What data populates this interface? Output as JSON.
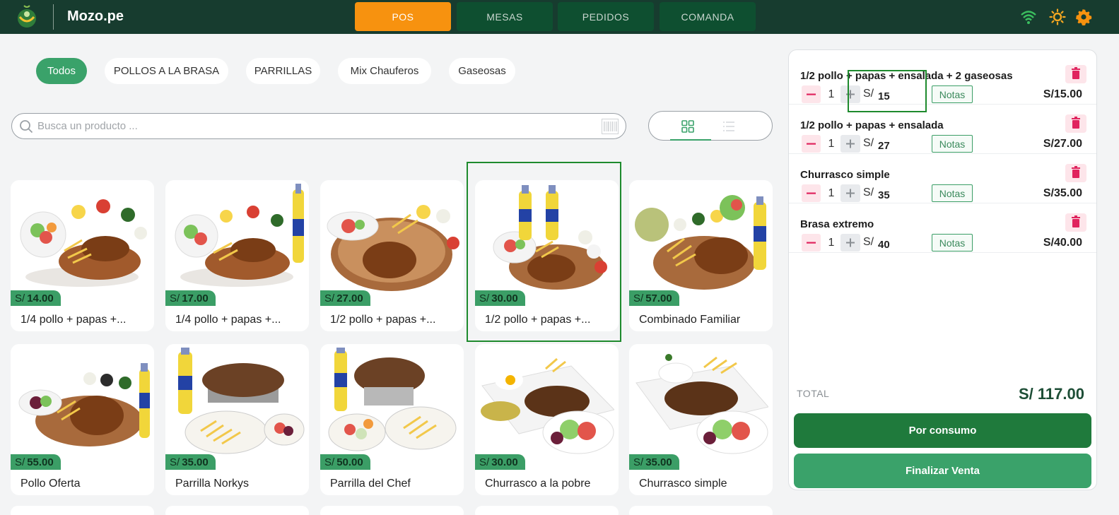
{
  "app": {
    "brand": "Mozo.pe"
  },
  "nav": [
    {
      "label": "POS",
      "active": true
    },
    {
      "label": "MESAS",
      "active": false
    },
    {
      "label": "PEDIDOS",
      "active": false
    },
    {
      "label": "COMANDA",
      "active": false
    }
  ],
  "topicons": [
    "wifi-icon",
    "sun-icon",
    "settings-icon"
  ],
  "categories": [
    {
      "label": "Todos",
      "active": true
    },
    {
      "label": "POLLOS A LA BRASA"
    },
    {
      "label": "PARRILLAS"
    },
    {
      "label": "Mix Chauferos"
    },
    {
      "label": "Gaseosas"
    }
  ],
  "search": {
    "placeholder": "Busca un producto ..."
  },
  "currency": "S/",
  "products": [
    {
      "name": "1/4 pollo + papas +...",
      "price": "14.00"
    },
    {
      "name": "1/4 pollo + papas +...",
      "price": "17.00"
    },
    {
      "name": "1/2 pollo + papas +...",
      "price": "27.00"
    },
    {
      "name": "1/2 pollo + papas +...",
      "price": "30.00"
    },
    {
      "name": "Combinado Familiar",
      "price": "57.00"
    },
    {
      "name": "Pollo Oferta",
      "price": "55.00"
    },
    {
      "name": "Parrilla Norkys",
      "price": "35.00"
    },
    {
      "name": "Parrilla del Chef",
      "price": "50.00"
    },
    {
      "name": "Churrasco a la pobre",
      "price": "30.00"
    },
    {
      "name": "Churrasco simple",
      "price": "35.00"
    }
  ],
  "order": {
    "items": [
      {
        "title": "1/2 pollo + papas + ensalada + 2 gaseosas",
        "qty": "1",
        "currency": "S/",
        "price": "15",
        "notes": "Notas",
        "subtotal": "S/15.00"
      },
      {
        "title": "1/2 pollo + papas + ensalada",
        "qty": "1",
        "currency": "S/",
        "price": "27",
        "notes": "Notas",
        "subtotal": "S/27.00"
      },
      {
        "title": "Churrasco simple",
        "qty": "1",
        "currency": "S/",
        "price": "35",
        "notes": "Notas",
        "subtotal": "S/35.00"
      },
      {
        "title": "Brasa extremo",
        "qty": "1",
        "currency": "S/",
        "price": "40",
        "notes": "Notas",
        "subtotal": "S/40.00"
      }
    ],
    "total_label": "TOTAL",
    "total_value": "S/ 117.00",
    "btn_consumo": "Por consumo",
    "btn_finalizar": "Finalizar Venta"
  }
}
